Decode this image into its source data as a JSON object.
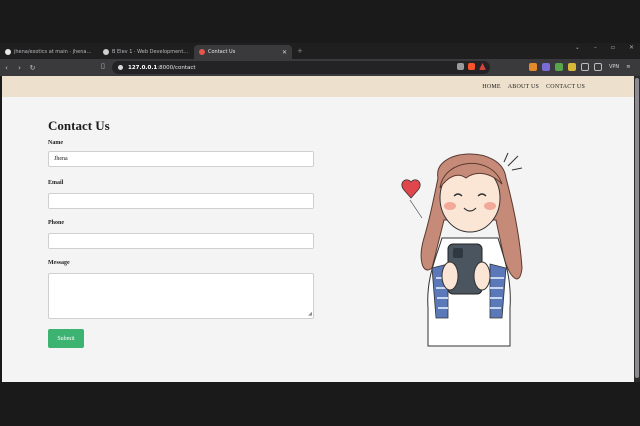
{
  "browser": {
    "tabs": [
      {
        "title": "jhena/exotics at main · jhena88/jhen",
        "active": false,
        "icon": "github-icon"
      },
      {
        "title": "B Elev 1 · Web Development: Lab 2",
        "active": false,
        "icon": "gear-icon"
      },
      {
        "title": "Contact Us",
        "active": true,
        "icon": "page-icon"
      }
    ],
    "new_tab_glyph": "+",
    "url_host": "127.0.0.1",
    "url_rest": ":8000/contact",
    "vpn_label": "VPN"
  },
  "site": {
    "nav": [
      "HOME",
      "ABOUT US",
      "CONTACT US"
    ],
    "title": "Contact Us",
    "fields": {
      "name_label": "Name",
      "name_value": "Jhena",
      "email_label": "Email",
      "phone_label": "Phone",
      "message_label": "Message"
    },
    "submit_label": "Submit"
  },
  "colors": {
    "navbar_bg": "#ede0cc",
    "submit_bg": "#3cb371",
    "page_bg": "#f4f4f4"
  }
}
